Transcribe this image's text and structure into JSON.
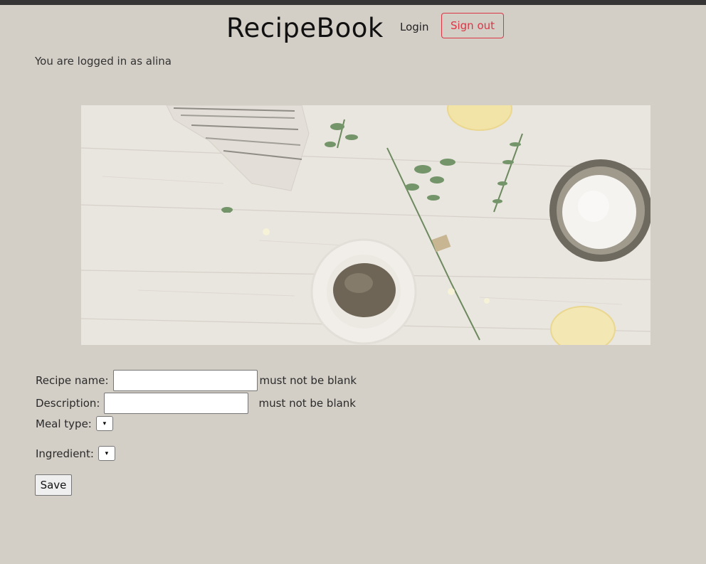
{
  "header": {
    "brand": "RecipeBook",
    "login_label": "Login",
    "signout_label": "Sign out"
  },
  "status": {
    "logged_in_text": "You are logged in as alina"
  },
  "form": {
    "recipe_name_label": "Recipe name:",
    "recipe_name_value": "",
    "recipe_name_error": "must not be blank",
    "description_label": "Description:",
    "description_value": "",
    "description_error": "must not be blank",
    "meal_type_label": "Meal type:",
    "ingredient_label": "Ingredient:",
    "save_label": "Save"
  },
  "icons": {
    "select_arrow": "chevron-down-icon"
  },
  "colors": {
    "background": "#d3cec6",
    "accent_danger": "#dc3545",
    "topbar": "#353535"
  }
}
